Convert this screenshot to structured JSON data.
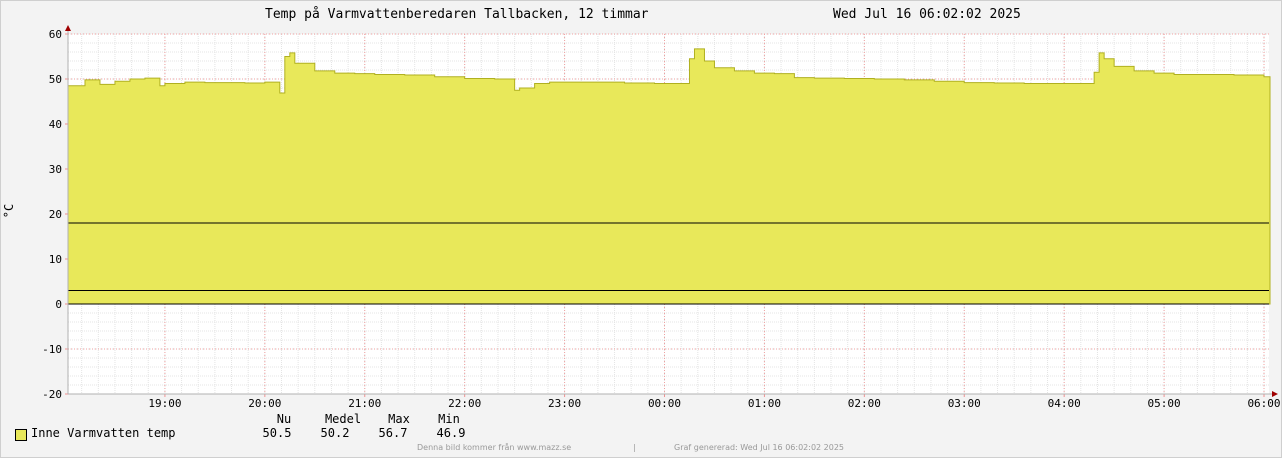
{
  "title": "Temp på Varmvatten­beredaren Tallbacken, 12 timmar",
  "timestamp": "Wed Jul 16 06:02:02 2025",
  "legend": {
    "label": "Inne Varmvatten temp",
    "swatch_color": "#e8e85a",
    "headers": [
      "Nu",
      "Medel",
      "Max",
      "Min"
    ],
    "values": [
      "50.5",
      "50.2",
      "56.7",
      "46.9"
    ]
  },
  "footer": {
    "left": "Denna bild kommer från www.mazz.se",
    "sep": "|",
    "right": "Graf genererad: Wed Jul 16 06:02:02 2025"
  },
  "chart_data": {
    "type": "area",
    "ylabel": "°C",
    "ylim": [
      -20,
      60
    ],
    "y_ticks": [
      -20,
      -10,
      0,
      10,
      20,
      30,
      40,
      50,
      60
    ],
    "x_ticks": [
      "19:00",
      "20:00",
      "21:00",
      "22:00",
      "23:00",
      "00:00",
      "01:00",
      "02:00",
      "03:00",
      "04:00",
      "05:00",
      "06:00"
    ],
    "x_range_hours": [
      -0.97,
      11.05
    ],
    "grid": true,
    "fill_color": "#e8e85a",
    "ref_lines": [
      18,
      3,
      0
    ],
    "series": [
      {
        "name": "Inne Varmvatten temp",
        "x": [
          -0.97,
          -0.8,
          -0.65,
          -0.5,
          -0.35,
          -0.2,
          -0.05,
          0.0,
          0.2,
          0.4,
          0.6,
          0.8,
          1.0,
          1.15,
          1.2,
          1.25,
          1.3,
          1.5,
          1.7,
          1.9,
          2.1,
          2.4,
          2.7,
          3.0,
          3.3,
          3.5,
          3.55,
          3.7,
          3.85,
          4.0,
          4.3,
          4.6,
          4.9,
          5.2,
          5.25,
          5.3,
          5.4,
          5.5,
          5.7,
          5.9,
          6.1,
          6.3,
          6.5,
          6.8,
          7.1,
          7.4,
          7.7,
          8.0,
          8.3,
          8.6,
          8.9,
          9.2,
          9.3,
          9.35,
          9.4,
          9.5,
          9.7,
          9.9,
          10.1,
          10.4,
          10.7,
          11.0
        ],
        "values": [
          48.5,
          49.8,
          48.8,
          49.5,
          50.0,
          50.2,
          48.5,
          49.0,
          49.3,
          49.2,
          49.2,
          49.1,
          49.3,
          46.9,
          55.0,
          55.8,
          53.5,
          51.8,
          51.3,
          51.2,
          51.0,
          50.9,
          50.5,
          50.1,
          50.0,
          47.5,
          48.0,
          49.0,
          49.3,
          49.3,
          49.3,
          49.1,
          49.0,
          49.0,
          54.5,
          56.7,
          54.0,
          52.5,
          51.8,
          51.3,
          51.2,
          50.3,
          50.2,
          50.1,
          50.0,
          49.8,
          49.5,
          49.2,
          49.1,
          49.0,
          49.0,
          49.0,
          51.5,
          55.8,
          54.5,
          52.8,
          51.8,
          51.3,
          51.0,
          51.0,
          50.9,
          50.5
        ]
      }
    ]
  }
}
